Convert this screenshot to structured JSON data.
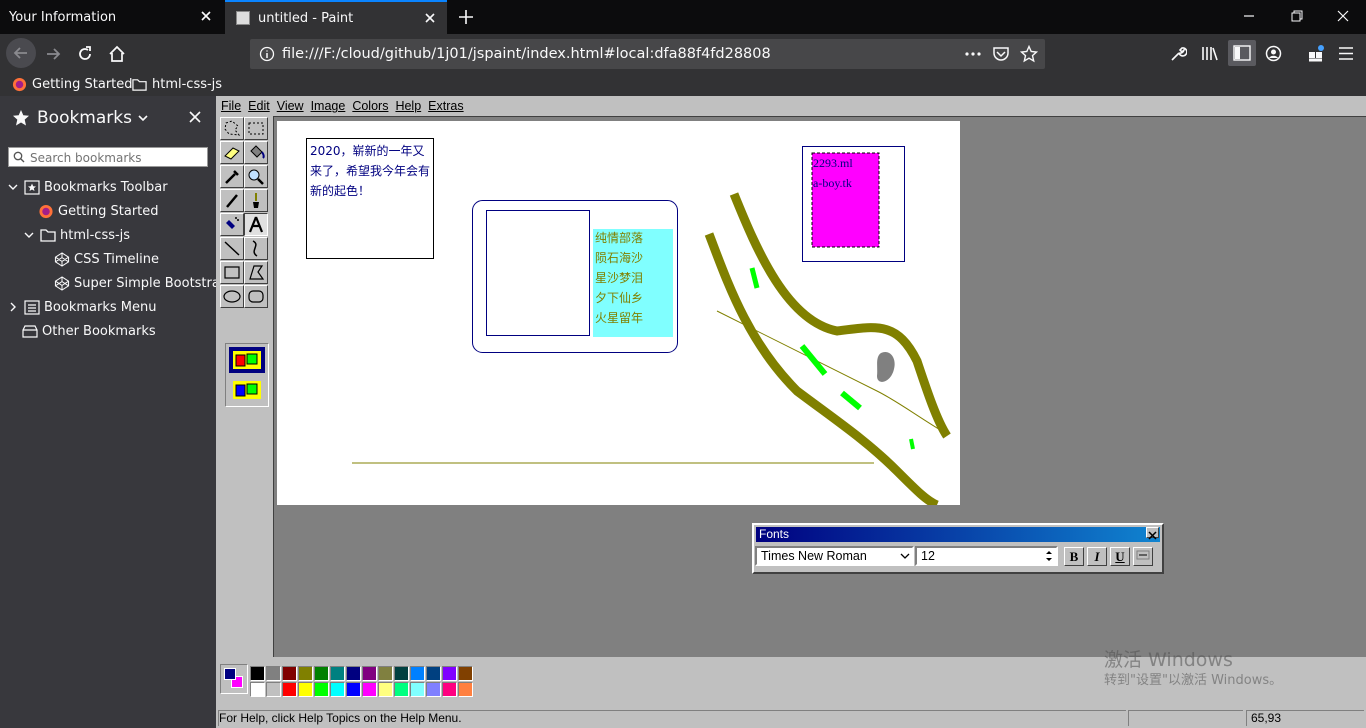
{
  "browser": {
    "tabs": [
      {
        "title": "Your Information"
      },
      {
        "title": "untitled - Paint"
      }
    ],
    "url": "file:///F:/cloud/github/1j01/jspaint/index.html#local:dfa88f4fd28808",
    "bookmarks_bar": [
      {
        "label": "Getting Started",
        "icon": "firefox-icon"
      },
      {
        "label": "html-css-js",
        "icon": "folder-icon"
      }
    ],
    "accent": "#0a84ff"
  },
  "sidebar": {
    "title": "Bookmarks",
    "search_placeholder": "Search bookmarks",
    "tree": [
      {
        "label": "Bookmarks Toolbar",
        "icon": "bookmarks-toolbar-icon"
      },
      {
        "label": "Getting Started",
        "icon": "firefox-icon"
      },
      {
        "label": "html-css-js",
        "icon": "folder-icon"
      },
      {
        "label": "CSS Timeline",
        "icon": "codepen-icon"
      },
      {
        "label": "Super Simple Bootstra...",
        "icon": "codepen-icon"
      },
      {
        "label": "Bookmarks Menu",
        "icon": "bookmarks-menu-icon"
      },
      {
        "label": "Other Bookmarks",
        "icon": "folder-icon"
      }
    ]
  },
  "paint": {
    "menu": [
      "File",
      "Edit",
      "View",
      "Image",
      "Colors",
      "Help",
      "Extras"
    ],
    "canvas": {
      "note1": [
        "2020，崭新的一年又",
        "来了，希望我今年会有",
        "新的起色！"
      ],
      "note2": [
        "纯情部落",
        "陨石海沙",
        "星沙梦泪",
        "夕下仙乡",
        "火星留年"
      ],
      "note3": [
        "2293.ml",
        "a-boy.tk"
      ]
    },
    "fonts_dialog": {
      "title": "Fonts",
      "font": "Times New Roman",
      "size": "12",
      "bold": "B",
      "italic": "I",
      "underline": "U"
    },
    "palette": [
      "#000000",
      "#808080",
      "#800000",
      "#808000",
      "#008000",
      "#008080",
      "#000080",
      "#800080",
      "#808040",
      "#004040",
      "#0080ff",
      "#004080",
      "#8000ff",
      "#804000",
      "#ffffff",
      "#c0c0c0",
      "#ff0000",
      "#ffff00",
      "#00ff00",
      "#00ffff",
      "#0000ff",
      "#ff00ff",
      "#ffff80",
      "#00ff80",
      "#80ffff",
      "#8080ff",
      "#ff0080",
      "#ff8040"
    ],
    "foreground_color": "#000080",
    "background_color": "#ff00ff",
    "status_help": "For Help, click Help Topics on the Help Menu.",
    "status_coords": "65,93"
  },
  "watermark": {
    "line1": "激活 Windows",
    "line2": "转到\"设置\"以激活 Windows。"
  }
}
